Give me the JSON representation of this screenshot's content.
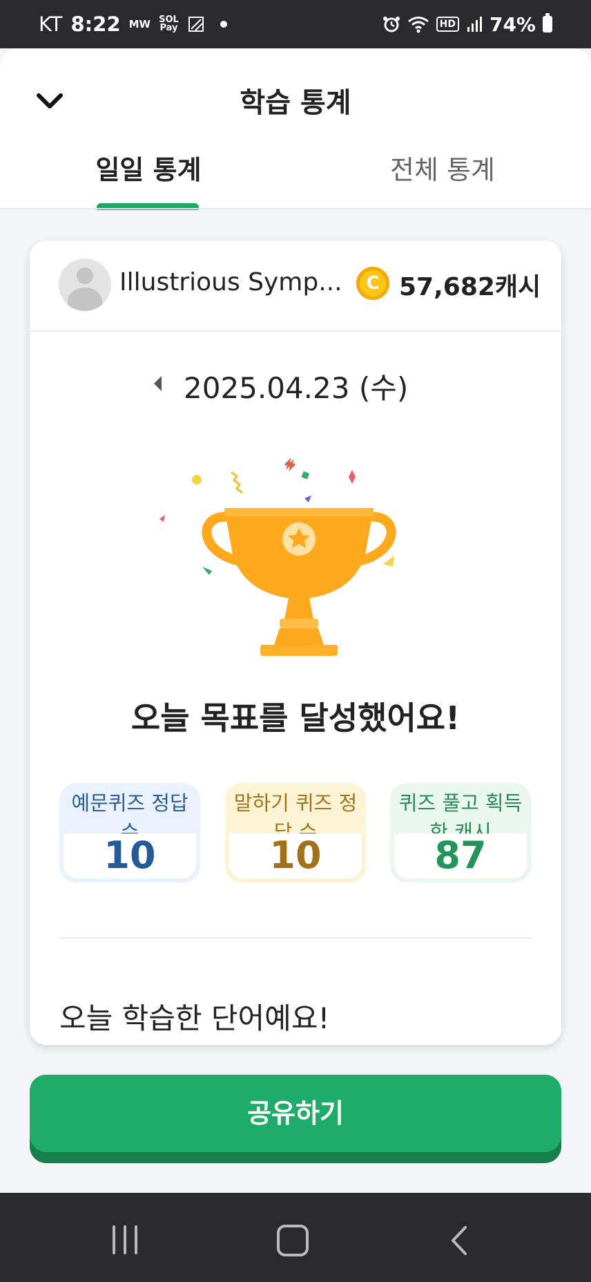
{
  "status_bar": {
    "carrier": "KT",
    "time": "8:22",
    "mw": "MW",
    "pay_top": "SOL",
    "pay_bottom": "Pay",
    "hd": "HD",
    "battery": "74%"
  },
  "header": {
    "title": "학습 통계",
    "tabs": [
      {
        "label": "일일 통계",
        "active": true
      },
      {
        "label": "전체 통계",
        "active": false
      }
    ]
  },
  "profile": {
    "username": "Illustrious Symp...",
    "coin_symbol": "C",
    "cash": "57,682캐시"
  },
  "date": {
    "value": "2025.04.23 (수)"
  },
  "achievement": {
    "message": "오늘 목표를 달성했어요!"
  },
  "stats": [
    {
      "label": "예문퀴즈 정답 수",
      "value": "10",
      "color": "#245a97"
    },
    {
      "label": "말하기 퀴즈 정답 수",
      "value": "10",
      "color": "#a2711c"
    },
    {
      "label": "퀴즈 풀고 획득한 캐시",
      "value": "87",
      "color": "#24955a"
    }
  ],
  "learned_words": {
    "title": "오늘 학습한 단어예요!"
  },
  "share_button": {
    "label": "공유하기",
    "color": "#1fab69"
  },
  "colors": {
    "accent": "#1fa868",
    "trophy": "#ffa91f",
    "coin": "#ffc61a"
  }
}
